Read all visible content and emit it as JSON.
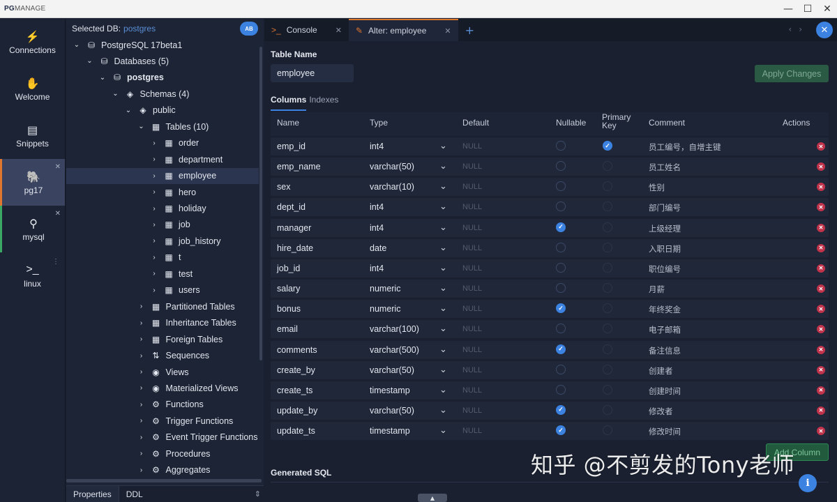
{
  "window": {
    "logo_bold": "PG",
    "logo_rest": "MANAGE",
    "controls": [
      "—",
      "☐",
      "✕"
    ]
  },
  "rail": [
    {
      "label": "Connections",
      "icon": "lightning-icon",
      "glyph": "⚡"
    },
    {
      "label": "Welcome",
      "icon": "hand-icon",
      "glyph": "✋"
    },
    {
      "label": "Snippets",
      "icon": "file-icon",
      "glyph": "▤"
    },
    {
      "label": "pg17",
      "icon": "postgres-icon",
      "glyph": "🐘"
    },
    {
      "label": "mysql",
      "icon": "mysql-icon",
      "glyph": "⚲"
    },
    {
      "label": "linux",
      "icon": "terminal-icon",
      "glyph": ">_"
    }
  ],
  "tree": {
    "selected_db_label": "Selected DB:",
    "selected_db_value": "postgres",
    "ab_label": "AB",
    "nodes": [
      {
        "label": "PostgreSQL 17beta1",
        "level": 0,
        "chev": "⌄",
        "icon": "⛁"
      },
      {
        "label": "Databases (5)",
        "level": 1,
        "chev": "⌄",
        "icon": "⛁"
      },
      {
        "label": "postgres",
        "level": 2,
        "chev": "⌄",
        "icon": "⛁"
      },
      {
        "label": "Schemas (4)",
        "level": 3,
        "chev": "⌄",
        "icon": "◈"
      },
      {
        "label": "public",
        "level": 4,
        "chev": "⌄",
        "icon": "◈"
      },
      {
        "label": "Tables (10)",
        "level": 5,
        "chev": "⌄",
        "icon": "▦"
      },
      {
        "label": "order",
        "level": 6,
        "chev": "›",
        "icon": "▦"
      },
      {
        "label": "department",
        "level": 6,
        "chev": "›",
        "icon": "▦"
      },
      {
        "label": "employee",
        "level": 6,
        "chev": "›",
        "icon": "▦"
      },
      {
        "label": "hero",
        "level": 6,
        "chev": "›",
        "icon": "▦"
      },
      {
        "label": "holiday",
        "level": 6,
        "chev": "›",
        "icon": "▦"
      },
      {
        "label": "job",
        "level": 6,
        "chev": "›",
        "icon": "▦"
      },
      {
        "label": "job_history",
        "level": 6,
        "chev": "›",
        "icon": "▦"
      },
      {
        "label": "t",
        "level": 6,
        "chev": "›",
        "icon": "▦"
      },
      {
        "label": "test",
        "level": 6,
        "chev": "›",
        "icon": "▦"
      },
      {
        "label": "users",
        "level": 6,
        "chev": "›",
        "icon": "▦"
      },
      {
        "label": "Partitioned Tables",
        "level": 5,
        "chev": "›",
        "icon": "▦"
      },
      {
        "label": "Inheritance Tables",
        "level": 5,
        "chev": "›",
        "icon": "▦"
      },
      {
        "label": "Foreign Tables",
        "level": 5,
        "chev": "›",
        "icon": "▦"
      },
      {
        "label": "Sequences",
        "level": 5,
        "chev": "›",
        "icon": "⇅"
      },
      {
        "label": "Views",
        "level": 5,
        "chev": "›",
        "icon": "◉"
      },
      {
        "label": "Materialized Views",
        "level": 5,
        "chev": "›",
        "icon": "◉"
      },
      {
        "label": "Functions",
        "level": 5,
        "chev": "›",
        "icon": "⚙"
      },
      {
        "label": "Trigger Functions",
        "level": 5,
        "chev": "›",
        "icon": "⚙"
      },
      {
        "label": "Event Trigger Functions",
        "level": 5,
        "chev": "›",
        "icon": "⚙"
      },
      {
        "label": "Procedures",
        "level": 5,
        "chev": "›",
        "icon": "⚙"
      },
      {
        "label": "Aggregates",
        "level": 5,
        "chev": "›",
        "icon": "⚙"
      }
    ],
    "bottom_tabs": [
      "Properties",
      "DDL"
    ]
  },
  "tabs": [
    {
      "label": "Console",
      "icon": "terminal-icon",
      "glyph": ">_",
      "active": false
    },
    {
      "label": "Alter: employee",
      "icon": "edit-icon",
      "glyph": "✎",
      "active": true
    }
  ],
  "editor": {
    "table_name_label": "Table Name",
    "table_name_value": "employee",
    "apply_label": "Apply Changes",
    "subtab_columns": "Columns",
    "subtab_indexes": "Indexes",
    "headers": {
      "name": "Name",
      "type": "Type",
      "default": "Default",
      "nullable": "Nullable",
      "pk1": "Primary",
      "pk2": "Key",
      "comment": "Comment",
      "actions": "Actions"
    },
    "default_placeholder": "NULL",
    "add_column_label": "Add Column",
    "generated_sql_label": "Generated SQL",
    "columns": [
      {
        "name": "emp_id",
        "type": "int4",
        "nullable": false,
        "pk": true,
        "comment": "员工编号，自增主键"
      },
      {
        "name": "emp_name",
        "type": "varchar(50)",
        "nullable": false,
        "pk": false,
        "comment": "员工姓名"
      },
      {
        "name": "sex",
        "type": "varchar(10)",
        "nullable": false,
        "pk": false,
        "comment": "性别"
      },
      {
        "name": "dept_id",
        "type": "int4",
        "nullable": false,
        "pk": false,
        "comment": "部门编号"
      },
      {
        "name": "manager",
        "type": "int4",
        "nullable": true,
        "pk": false,
        "comment": "上级经理"
      },
      {
        "name": "hire_date",
        "type": "date",
        "nullable": false,
        "pk": false,
        "comment": "入职日期"
      },
      {
        "name": "job_id",
        "type": "int4",
        "nullable": false,
        "pk": false,
        "comment": "职位编号"
      },
      {
        "name": "salary",
        "type": "numeric",
        "nullable": false,
        "pk": false,
        "comment": "月薪"
      },
      {
        "name": "bonus",
        "type": "numeric",
        "nullable": true,
        "pk": false,
        "comment": "年终奖金"
      },
      {
        "name": "email",
        "type": "varchar(100)",
        "nullable": false,
        "pk": false,
        "comment": "电子邮箱"
      },
      {
        "name": "comments",
        "type": "varchar(500)",
        "nullable": true,
        "pk": false,
        "comment": "备注信息"
      },
      {
        "name": "create_by",
        "type": "varchar(50)",
        "nullable": false,
        "pk": false,
        "comment": "创建者"
      },
      {
        "name": "create_ts",
        "type": "timestamp",
        "nullable": false,
        "pk": false,
        "comment": "创建时间"
      },
      {
        "name": "update_by",
        "type": "varchar(50)",
        "nullable": true,
        "pk": false,
        "comment": "修改者"
      },
      {
        "name": "update_ts",
        "type": "timestamp",
        "nullable": true,
        "pk": false,
        "comment": "修改时间"
      }
    ]
  },
  "watermark": "知乎 @不剪发的Tony老师",
  "colors": {
    "accent": "#3c82e0",
    "active_tab": "#e0772e",
    "danger": "#c0334b",
    "success": "#2d8a55"
  }
}
